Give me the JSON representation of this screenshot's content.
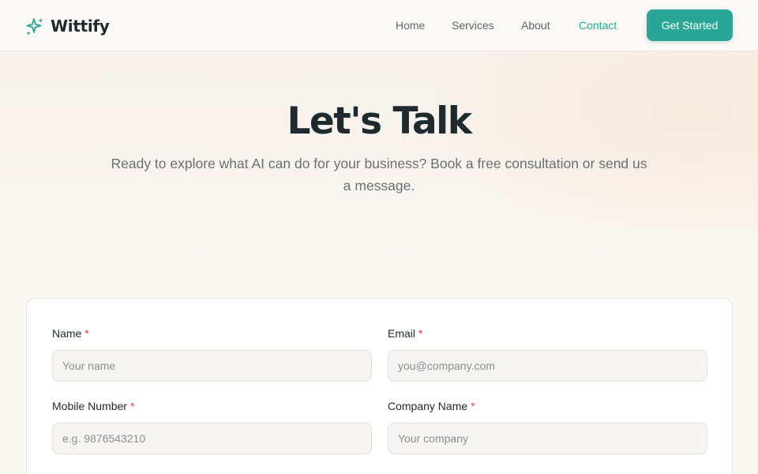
{
  "brand": {
    "name": "Wittify",
    "logo_icon": "sparkle-icon",
    "accent": "#2aa696"
  },
  "nav": {
    "items": [
      {
        "label": "Home",
        "active": false
      },
      {
        "label": "Services",
        "active": false
      },
      {
        "label": "About",
        "active": false
      },
      {
        "label": "Contact",
        "active": true
      }
    ],
    "cta_label": "Get Started"
  },
  "hero": {
    "title": "Let's Talk",
    "subtitle": "Ready to explore what AI can do for your business? Book a free consultation or send us a message."
  },
  "form": {
    "required_marker": "*",
    "fields": [
      {
        "label": "Name",
        "placeholder": "Your name",
        "value": ""
      },
      {
        "label": "Email",
        "placeholder": "you@company.com",
        "value": ""
      },
      {
        "label": "Mobile Number",
        "placeholder": "e.g. 9876543210",
        "value": ""
      },
      {
        "label": "Company Name",
        "placeholder": "Your company",
        "value": ""
      }
    ]
  }
}
